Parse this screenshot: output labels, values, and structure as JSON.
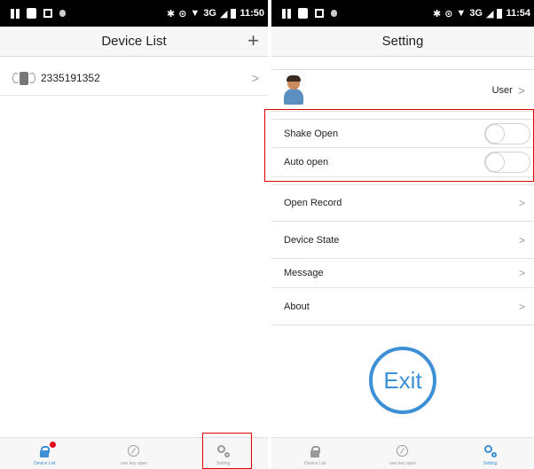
{
  "status_left": {
    "time": "11:50",
    "network": "3G"
  },
  "status_right": {
    "time": "11:54",
    "network": "3G"
  },
  "device_list": {
    "title": "Device List",
    "add_icon": "+",
    "devices": [
      {
        "id": "2335191352"
      }
    ]
  },
  "tabs": [
    {
      "label": "Device List",
      "icon": "lock-icon"
    },
    {
      "label": "one key open",
      "icon": "compass-icon"
    },
    {
      "label": "Setting",
      "icon": "gear-icon"
    }
  ],
  "setting": {
    "title": "Setting",
    "user_label": "User",
    "shake_open": {
      "label": "Shake Open",
      "on": false
    },
    "auto_open": {
      "label": "Auto open",
      "on": false
    },
    "open_record": "Open Record",
    "device_state": "Device State",
    "message": "Message",
    "about": "About",
    "exit": "Exit"
  },
  "colors": {
    "accent": "#3d8fd6",
    "highlight": "#e30000",
    "badge": "#e8001a"
  }
}
